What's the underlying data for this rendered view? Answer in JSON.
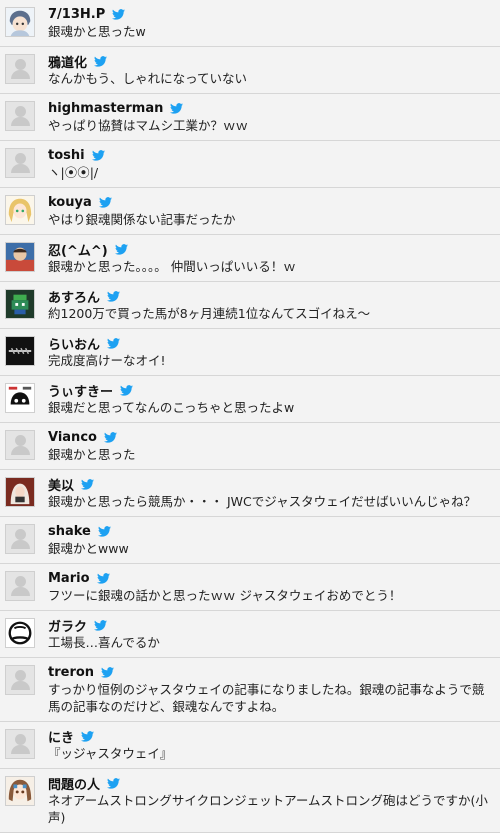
{
  "accent": "#1da1f2",
  "items": [
    {
      "name": "7/13H.P",
      "text": "銀魂かと思ったw",
      "avatar": "anime-avatar-blue"
    },
    {
      "name": "鴉道化",
      "text": "なんかもう、しゃれになっていない",
      "avatar": "no-image"
    },
    {
      "name": "highmasterman",
      "text": "やっぱり協賛はマムシ工業か？ｗｗ",
      "avatar": "no-image"
    },
    {
      "name": "toshi",
      "text": "ヽ|⦿⦿|/",
      "avatar": "no-image"
    },
    {
      "name": "kouya",
      "text": "やはり銀魂関係ない記事だったか",
      "avatar": "anime-avatar-blonde"
    },
    {
      "name": "忍(^ム^)",
      "text": "銀魂かと思った。。。。 仲間いっぱいいる！ｗ",
      "avatar": "photo-avatar"
    },
    {
      "name": "あすろん",
      "text": "約1200万で買った馬が8ヶ月連続1位なんてスゴイねえ〜",
      "avatar": "pixel-avatar"
    },
    {
      "name": "らいおん",
      "text": "完成度高けーなオイ!",
      "avatar": "logo-avatar-black"
    },
    {
      "name": "うぃすきー",
      "text": "銀魂だと思ってなんのこっちゃと思ったよw",
      "avatar": "manga-avatar"
    },
    {
      "name": "Vianco",
      "text": "銀魂かと思った",
      "avatar": "no-image"
    },
    {
      "name": "美以",
      "text": "銀魂かと思ったら競馬か・・・ JWCでジャスタウェイだせばいいんじゃね？",
      "avatar": "anime-avatar-red"
    },
    {
      "name": "shake",
      "text": "銀魂かとwww",
      "avatar": "no-image"
    },
    {
      "name": "Mario",
      "text": "フツーに銀魂の話かと思ったｗｗ ジャスタウェイおめでとう！",
      "avatar": "no-image"
    },
    {
      "name": "ガラク",
      "text": "工場長…喜んでるか",
      "avatar": "circle-logo-avatar"
    },
    {
      "name": "treron",
      "text": "すっかり恒例のジャスタウェイの記事になりましたね。銀魂の記事なようで競馬の記事なのだけど、銀魂なんですよね。",
      "avatar": "no-image"
    },
    {
      "name": "にき",
      "text": "『ッジャスタウェイ』",
      "avatar": "no-image"
    },
    {
      "name": "問題の人",
      "text": "ネオアームストロングサイクロンジェットアームストロング砲はどうですか(小声)",
      "avatar": "anime-avatar-brown"
    }
  ]
}
